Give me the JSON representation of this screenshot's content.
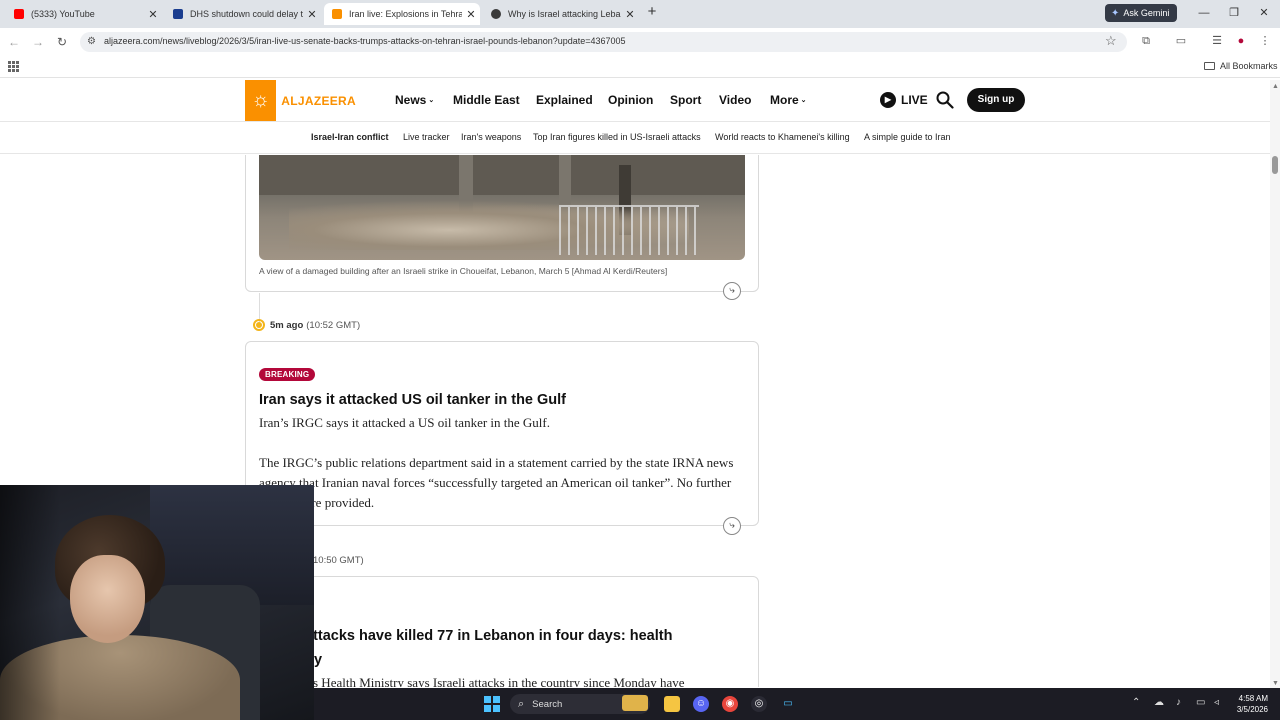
{
  "browser": {
    "tabs": [
      {
        "title": "(5333) YouTube",
        "favicon_color": "#ff0000",
        "active": false
      },
      {
        "title": "DHS shutdown could delay ter",
        "favicon_color": "#1a3d8f",
        "active": false
      },
      {
        "title": "Iran live: Explosions in Tehran a",
        "favicon_color": "#fa9000",
        "active": true
      },
      {
        "title": "Why is Israel attacking Lebanon",
        "favicon_color": "#3a3a3a",
        "active": false
      }
    ],
    "new_tab_glyph": "+",
    "gemini_label": "Ask Gemini",
    "url": "aljazeera.com/news/liveblog/2026/3/5/iran-live-us-senate-backs-trumps-attacks-on-tehran-israel-pounds-lebanon?update=4367005",
    "all_bookmarks": "All Bookmarks"
  },
  "site": {
    "logo_text": "ALJAZEERA",
    "brand_color": "#fa9000",
    "nav": [
      {
        "label": "News",
        "dropdown": true
      },
      {
        "label": "Middle East",
        "dropdown": false
      },
      {
        "label": "Explained",
        "dropdown": false
      },
      {
        "label": "Opinion",
        "dropdown": false
      },
      {
        "label": "Sport",
        "dropdown": false
      },
      {
        "label": "Video",
        "dropdown": false
      },
      {
        "label": "More",
        "dropdown": true
      }
    ],
    "live_label": "LIVE",
    "signup_label": "Sign up",
    "subnav": [
      "Israel-Iran conflict",
      "Live tracker",
      "Iran's weapons",
      "Top Iran figures killed in US-Israeli attacks",
      "World reacts to Khamenei's killing",
      "A simple guide to Iran"
    ]
  },
  "liveblog": {
    "photo_caption": "A view of a damaged building after an Israeli strike in Choueifat, Lebanon, March 5 [Ahmad Al Kerdi/Reuters]",
    "update1": {
      "ago": "5m ago",
      "gmt": "(10:52 GMT)",
      "badge": "BREAKING",
      "badge_color": "#b3083a",
      "headline": "Iran says it attacked US oil tanker in the Gulf",
      "para1": "Iran’s IRGC says it attacked a US oil tanker in the Gulf.",
      "para2": "The IRGC’s public relations department said in a statement carried by the state IRNA news agency that Iranian naval forces “successfully targeted an American oil tanker”. No further details were provided."
    },
    "update2": {
      "gmt_partial": "10:50 GMT)",
      "headline_partial": "attacks have killed 77 in Lebanon in four days: health",
      "headline_line2_partial": "y",
      "body_partial": "s Health Ministry says Israeli attacks in the country since Monday have"
    }
  },
  "taskbar": {
    "search_label": "Search",
    "time": "4:58 AM",
    "date": "3/5/2026"
  }
}
